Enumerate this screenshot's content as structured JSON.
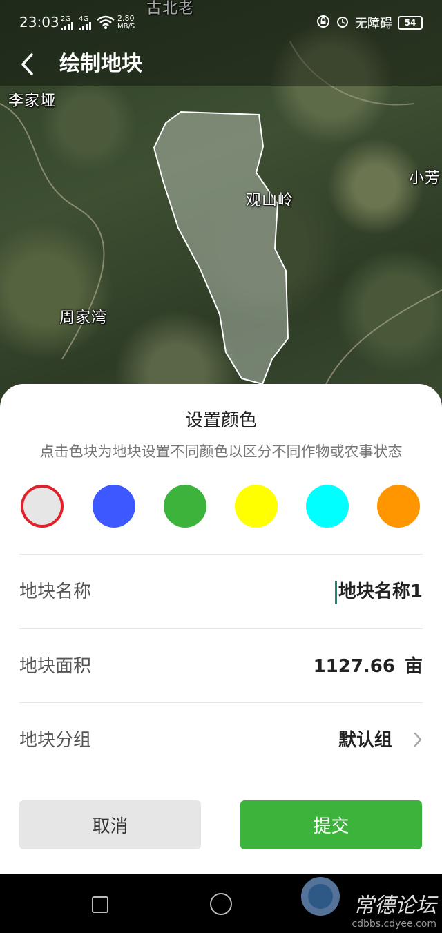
{
  "status_bar": {
    "time": "23:03",
    "net1": "2G",
    "net2": "4G",
    "speed": "2.80",
    "speed_unit": "MB/S",
    "accessibility": "无障碍",
    "battery": "54"
  },
  "header": {
    "title": "绘制地块"
  },
  "map": {
    "places": [
      "古北老",
      "李家垭",
      "小芳",
      "观山岭",
      "周家湾"
    ]
  },
  "sheet": {
    "title": "设置颜色",
    "subtitle": "点击色块为地块设置不同颜色以区分不同作物或农事状态",
    "swatches": [
      "#e6e6e6",
      "#3d58ff",
      "#3cb43c",
      "#ffff00",
      "#00ffff",
      "#ff9600"
    ],
    "selected_swatch_index": 0,
    "rows": {
      "name": {
        "label": "地块名称",
        "value": "地块名称1"
      },
      "area": {
        "label": "地块面积",
        "value": "1127.66",
        "unit": "亩"
      },
      "group": {
        "label": "地块分组",
        "value": "默认组"
      }
    },
    "cancel_label": "取消",
    "submit_label": "提交"
  },
  "watermark": {
    "main": "常德论坛",
    "sub": "cdbbs.cdyee.com"
  }
}
